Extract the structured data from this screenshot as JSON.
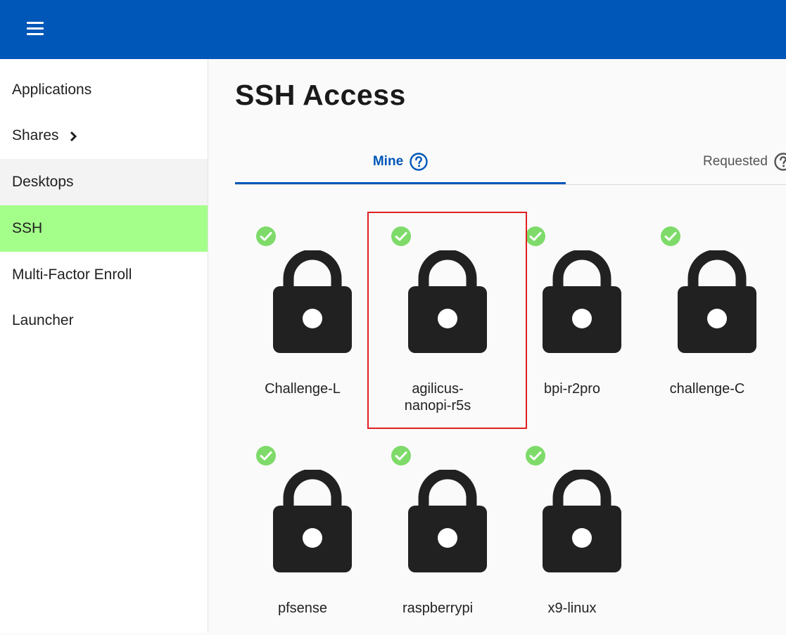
{
  "header": {
    "menu_icon": "hamburger-menu-icon",
    "bg_color": "#0057b8"
  },
  "sidebar": {
    "items": [
      {
        "label": "Applications"
      },
      {
        "label": "Shares",
        "icon": "chevron-right-icon"
      },
      {
        "label": "Desktops"
      },
      {
        "label": "SSH",
        "active": true,
        "color": "#a4ff8a"
      },
      {
        "label": "Multi-Factor Enroll"
      },
      {
        "label": "Launcher"
      }
    ]
  },
  "main": {
    "title": "SSH Access",
    "tabs": [
      {
        "label": "Mine",
        "icon": "help-circle-icon",
        "selected": true
      },
      {
        "label": "Requested",
        "icon": "help-circle-icon"
      }
    ],
    "tiles": [
      {
        "label": "Challenge-L",
        "status_icon": "check-circle-icon",
        "icon": "lock-icon"
      },
      {
        "label": "agilicus-nanopi-r5s",
        "status_icon": "check-circle-icon",
        "icon": "lock-icon",
        "highlighted": true
      },
      {
        "label": "bpi-r2pro",
        "status_icon": "check-circle-icon",
        "icon": "lock-icon"
      },
      {
        "label": "challenge-C",
        "status_icon": "check-circle-icon",
        "icon": "lock-icon"
      },
      {
        "label": "pfsense",
        "status_icon": "check-circle-icon",
        "icon": "lock-icon"
      },
      {
        "label": "raspberrypi",
        "status_icon": "check-circle-icon",
        "icon": "lock-icon"
      },
      {
        "label": "x9-linux",
        "status_icon": "check-circle-icon",
        "icon": "lock-icon"
      }
    ]
  },
  "colors": {
    "accent": "#0057b8",
    "check": "#7edb6a",
    "highlight": "#e02020"
  }
}
